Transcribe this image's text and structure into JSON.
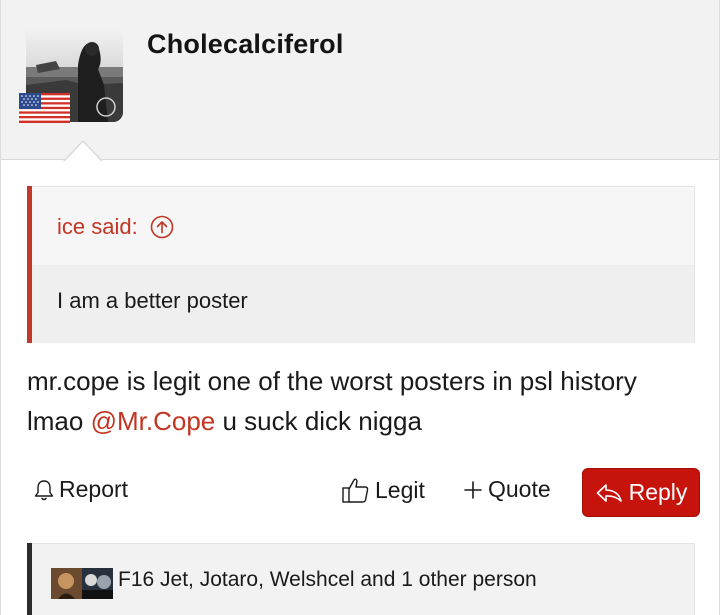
{
  "user": {
    "name": "Cholecalciferol",
    "flag_icon": "us-flag-icon",
    "avatar_icon": "user-avatar-icon"
  },
  "quote": {
    "author_label": "ice said:",
    "goto_icon": "arrow-up-circle-icon",
    "text": "I am a better poster"
  },
  "message": {
    "text_before": "mr.cope is legit one of the worst posters in psl history lmao ",
    "mention": "@Mr.Cope",
    "text_after": " u suck dick nigga"
  },
  "actions": {
    "report_label": "Report",
    "legit_label": "Legit",
    "quote_label": "Quote",
    "reply_label": "Reply",
    "accent_color": "#c6130c"
  },
  "reactions": {
    "text": "F16 Jet, Jotaro, Welshcel and 1 other person"
  },
  "colors": {
    "link": "#c23523",
    "quote_bar": "#c0392b",
    "header_bg": "#f2f2f2"
  }
}
